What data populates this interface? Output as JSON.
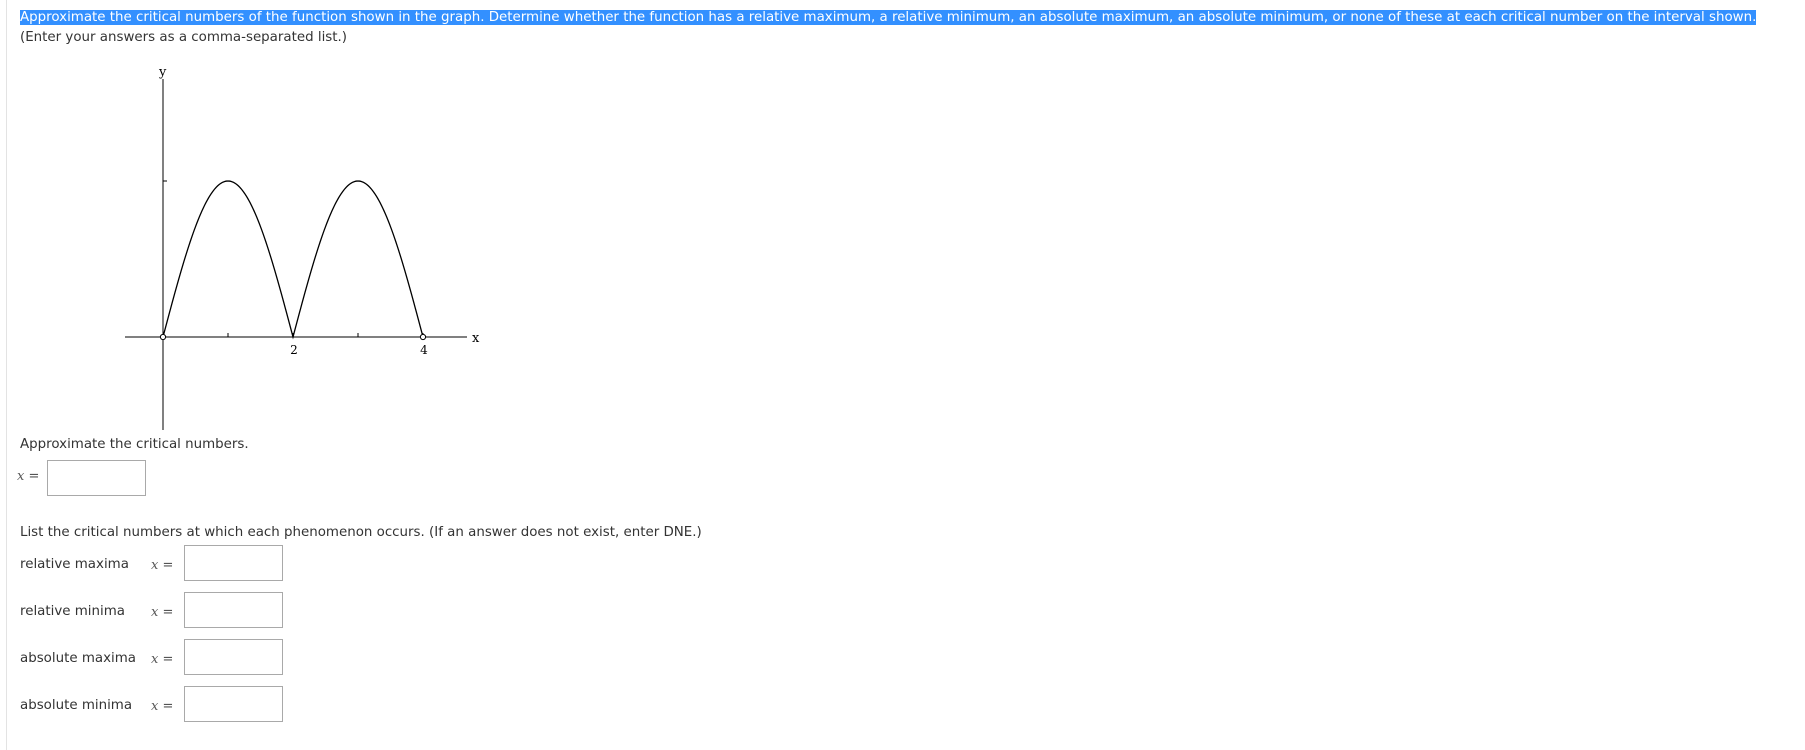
{
  "question": {
    "highlighted": "Approximate the critical numbers of the function shown in the graph. Determine whether the function has a relative maximum, a relative minimum, an absolute maximum, an absolute minimum, or none of these at each critical number on the interval shown.",
    "rest": " (Enter your answers as a comma-separated list.)"
  },
  "graph": {
    "y_axis_label": "y",
    "x_axis_label": "x",
    "x_tick_labels": [
      "2",
      "4"
    ]
  },
  "chart_data": {
    "type": "line",
    "x": [
      0,
      0.5,
      1,
      1.5,
      2,
      2.5,
      3,
      3.5,
      4
    ],
    "y": [
      0,
      0.75,
      1,
      0.75,
      0,
      0.75,
      1,
      0.75,
      0
    ],
    "xlim": [
      -0.3,
      4.3
    ],
    "open_endpoints": [
      0,
      4
    ],
    "xticks": [
      1,
      2,
      3,
      4
    ],
    "xtick_labels": [
      "",
      "2",
      "",
      "4"
    ],
    "title": "",
    "xlabel": "x",
    "ylabel": "y",
    "grid": false
  },
  "critical_numbers": {
    "prompt": "Approximate the critical numbers.",
    "x_label": "x",
    "eq": "=",
    "value": ""
  },
  "phenomena": {
    "prompt": "List the critical numbers at which each phenomenon occurs. (If an answer does not exist, enter DNE.)",
    "rows": [
      {
        "label": "relative maxima",
        "x_label": "x",
        "eq": "=",
        "value": ""
      },
      {
        "label": "relative minima",
        "x_label": "x",
        "eq": "=",
        "value": ""
      },
      {
        "label": "absolute maxima",
        "x_label": "x",
        "eq": "=",
        "value": ""
      },
      {
        "label": "absolute minima",
        "x_label": "x",
        "eq": "=",
        "value": ""
      }
    ]
  }
}
